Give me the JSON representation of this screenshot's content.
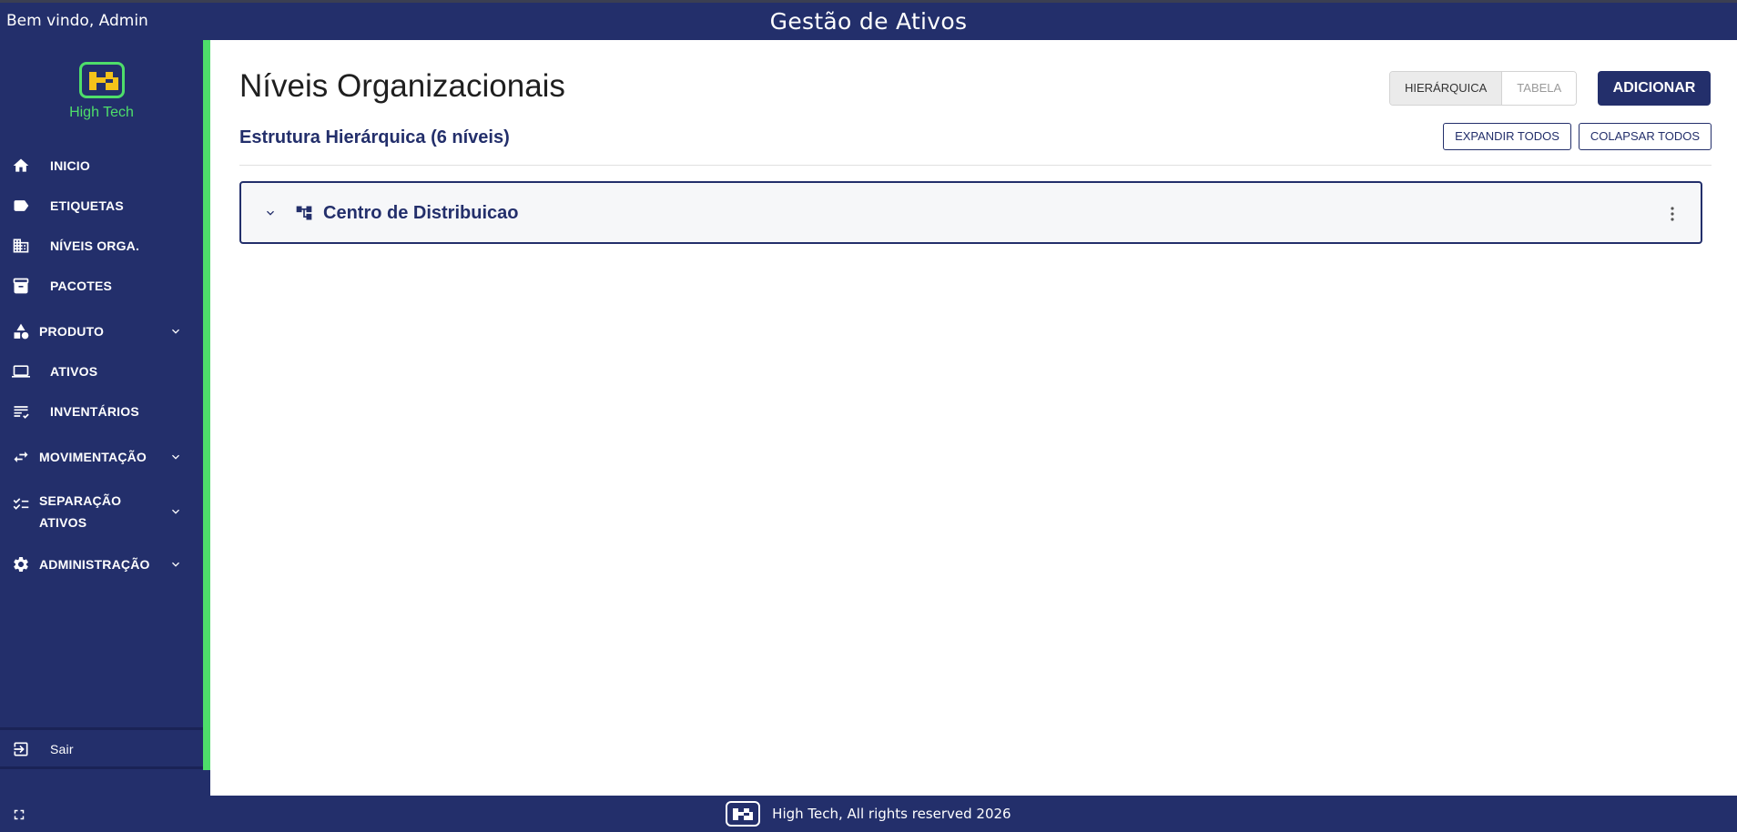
{
  "header": {
    "welcome": "Bem vindo, Admin",
    "app_title": "Gestão de Ativos"
  },
  "logo": {
    "name": "High Tech",
    "icon": "high-tech-logo"
  },
  "sidebar": {
    "items": [
      {
        "label": "INICIO",
        "icon": "home-icon"
      },
      {
        "label": "ETIQUETAS",
        "icon": "label-icon"
      },
      {
        "label": "NÍVEIS ORGA.",
        "icon": "building-icon"
      },
      {
        "label": "PACOTES",
        "icon": "archive-icon"
      },
      {
        "label": "PRODUTO",
        "icon": "category-icon",
        "expandable": true
      },
      {
        "label": "ATIVOS",
        "icon": "laptop-icon"
      },
      {
        "label": "INVENTÁRIOS",
        "icon": "checklist-icon"
      },
      {
        "label": "MOVIMENTAÇÃO",
        "icon": "swap-icon",
        "expandable": true
      },
      {
        "label_line1": "SEPARAÇÃO",
        "label_line2": "ATIVOS",
        "icon": "list-check-icon",
        "expandable": true
      },
      {
        "label": "ADMINISTRAÇÃO",
        "icon": "gear-icon",
        "expandable": true
      }
    ],
    "logout": {
      "label": "Sair",
      "icon": "logout-icon"
    }
  },
  "main": {
    "title": "Níveis Organizacionais",
    "subtitle": "Estrutura Hierárquica (6 níveis)",
    "view_toggle": {
      "options": [
        "HIERÁRQUICA",
        "TABELA"
      ],
      "selected": "HIERÁRQUICA"
    },
    "add_label": "ADICIONAR",
    "expand_all_label": "EXPANDIR TODOS",
    "collapse_all_label": "COLAPSAR TODOS",
    "tree": [
      {
        "label": "Centro de Distribuicao",
        "icon": "hierarchy-icon",
        "expanded": false
      }
    ]
  },
  "footer": {
    "text": "High Tech, All rights reserved 2026",
    "fullscreen_icon": "fullscreen-icon"
  },
  "colors": {
    "brand_navy": "#232f6b",
    "accent_green": "#4ede6a",
    "logo_yellow": "#f4c21a"
  }
}
